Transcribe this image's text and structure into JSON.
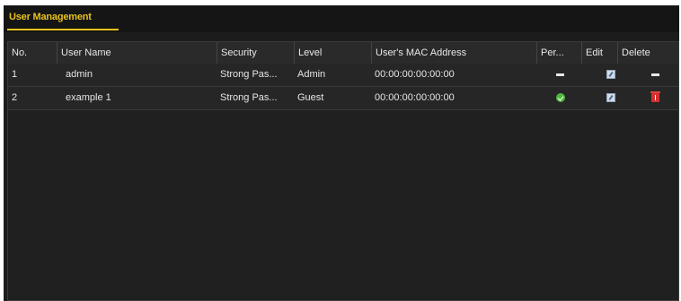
{
  "tab": {
    "label": "User Management"
  },
  "table": {
    "headers": {
      "no": "No.",
      "user_name": "User Name",
      "security": "Security",
      "level": "Level",
      "mac": "User's MAC Address",
      "permission": "Per...",
      "edit": "Edit",
      "delete": "Delete"
    },
    "rows": [
      {
        "no": "1",
        "user_name": "admin",
        "security": "Strong Pas...",
        "level": "Admin",
        "mac": "00:00:00:00:00:00",
        "permission_icon": "dash-icon",
        "edit_icon": "edit-icon",
        "delete_icon": "dash-icon"
      },
      {
        "no": "2",
        "user_name": "example 1",
        "security": "Strong Pas...",
        "level": "Guest",
        "mac": "00:00:00:00:00:00",
        "permission_icon": "check-icon",
        "edit_icon": "edit-icon",
        "delete_icon": "delete-icon"
      }
    ]
  },
  "colors": {
    "accent": "#e6c21a",
    "panel_bg": "#1c1c1c",
    "row_bg": "#262626",
    "check_green": "#4fb83d",
    "delete_red": "#d62f2f"
  }
}
